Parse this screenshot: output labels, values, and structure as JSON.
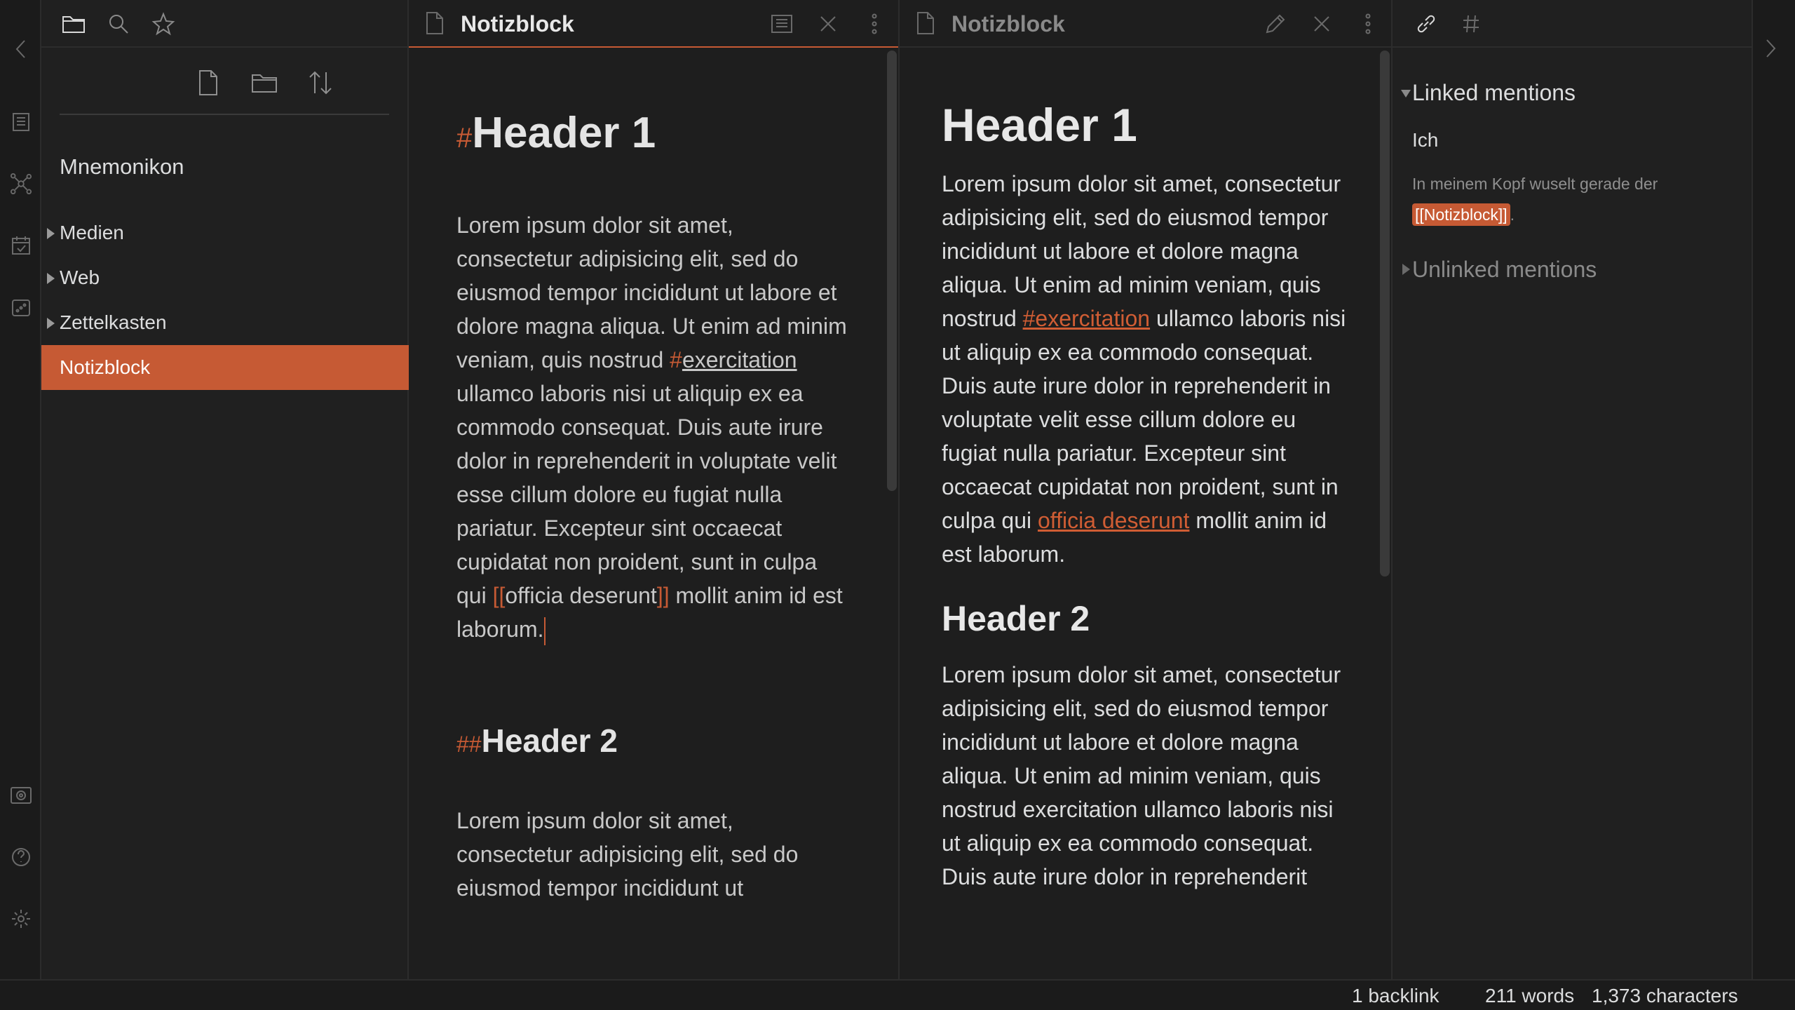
{
  "explorer": {
    "vault_name": "Mnemonikon",
    "tree": [
      {
        "label": "Medien",
        "type": "folder"
      },
      {
        "label": "Web",
        "type": "folder"
      },
      {
        "label": "Zettelkasten",
        "type": "folder"
      },
      {
        "label": "Notizblock",
        "type": "file",
        "active": true
      }
    ]
  },
  "source_pane": {
    "title": "Notizblock",
    "h1_mark": "#",
    "h1": "Header 1",
    "p1_before": "Lorem ipsum dolor sit amet, consectetur adipisicing elit, sed do eiusmod tempor incididunt ut labore et dolore magna aliqua. Ut enim ad minim veniam, quis nostrud ",
    "tag_mark": "#",
    "tag": "exercitation",
    "p1_mid": " ullamco laboris nisi ut aliquip ex ea commodo consequat. Duis aute irure dolor in reprehenderit in voluptate velit esse cillum dolore eu fugiat nulla pariatur. Excepteur sint occaecat cupidatat non proident, sunt in culpa qui ",
    "link_open": "[[",
    "link_text": "officia deserunt",
    "link_close": "]]",
    "p1_after": " mollit anim id est laborum.",
    "h2_mark": "##",
    "h2": "Header 2",
    "p2": "Lorem ipsum dolor sit amet, consectetur adipisicing elit, sed do eiusmod tempor incididunt ut"
  },
  "preview_pane": {
    "title": "Notizblock",
    "h1": "Header 1",
    "p1_before": "Lorem ipsum dolor sit amet, consectetur adipisicing elit, sed do eiusmod tempor incididunt ut labore et dolore magna aliqua. Ut enim ad minim veniam, quis nostrud ",
    "tag": "#exercitation",
    "p1_mid": " ullamco laboris nisi ut aliquip ex ea commodo consequat. Duis aute irure dolor in reprehenderit in voluptate velit esse cillum dolore eu fugiat nulla pariatur. Excepteur sint occaecat cupidatat non proident, sunt in culpa qui ",
    "link": "officia deserunt",
    "p1_after": " mollit anim id est laborum.",
    "h2": "Header 2",
    "p2": "Lorem ipsum dolor sit amet, consectetur adipisicing elit, sed do eiusmod tempor incididunt ut labore et dolore magna aliqua. Ut enim ad minim veniam, quis nostrud exercitation ullamco laboris nisi ut aliquip ex ea commodo consequat. Duis aute irure dolor in reprehenderit"
  },
  "backlinks": {
    "linked_title": "Linked mentions",
    "mention_file": "Ich",
    "mention_before": "In meinem Kopf wuselt gerade der ",
    "mention_highlight": "[[Notizblock]]",
    "mention_after": ".",
    "unlinked_title": "Unlinked mentions"
  },
  "status": {
    "backlinks": "1 backlink",
    "words": "211 words",
    "characters": "1,373 characters"
  },
  "colors": {
    "accent": "#c65a34",
    "background": "#1e1e1e",
    "text": "#dcddde"
  }
}
